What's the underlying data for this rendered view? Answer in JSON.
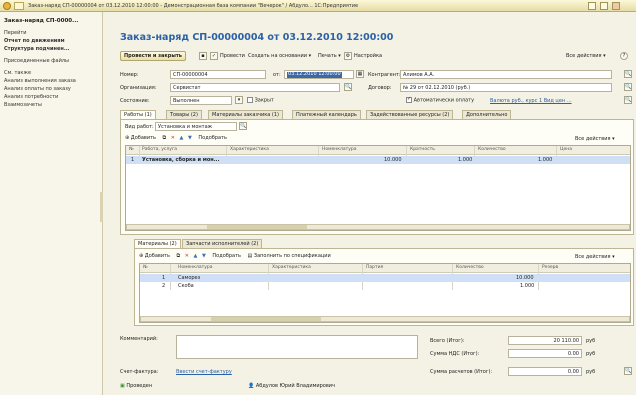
{
  "window": {
    "title": "Заказ-наряд СП-00000004 от 03.12.2010 12:00:00 - Демонстрационная база компании \"Вечерок\" / Абдуло... 1С:Предприятие"
  },
  "sidebar": {
    "items": [
      {
        "label": "Заказ-наряд СП-0000...",
        "bold": true
      },
      {
        "label": "Перейти",
        "bold": false
      },
      {
        "label": "Отчет по движениям",
        "bold": true
      },
      {
        "label": "Структура подчинен...",
        "bold": true
      },
      {
        "label": "Присоединенные файлы",
        "bold": false
      },
      {
        "label": "См. также",
        "bold": false
      },
      {
        "label": "Анализ выполнения заказа",
        "bold": false
      },
      {
        "label": "Анализ оплаты по заказу",
        "bold": false
      },
      {
        "label": "Анализ потребности",
        "bold": false
      },
      {
        "label": "Взаимозачеты",
        "bold": false
      }
    ]
  },
  "doc": {
    "title": "Заказ-наряд СП-00000004 от 03.12.2010 12:00:00"
  },
  "toolbar": {
    "post_close": "Провести и закрыть",
    "post": "Провести",
    "create_based": "Создать на основании",
    "print": "Печать",
    "settings": "Настройка",
    "all_actions": "Все действия"
  },
  "fields": {
    "number_label": "Номер:",
    "number_value": "СП-00000004",
    "date_label": "от:",
    "date_value": "03.12.2010 12:00:00",
    "counterparty_label": "Контрагент:",
    "counterparty_value": "Алимов А.А.",
    "org_label": "Организация:",
    "org_value": "Сервистат",
    "contract_label": "Договор:",
    "contract_value": "№ 29 от 02.12.2010 (руб.)",
    "state_label": "Состояние:",
    "state_value": "Выполнен",
    "closed_label": "Закрыт",
    "auto_pay_label": "Автоматически оплату",
    "currency_label": "Валюта руб., курс 1 Вид цен ..."
  },
  "tabs": [
    "Работы (1)",
    "Товары (2)",
    "Материалы заказчика (1)",
    "Платежный календарь",
    "Задействованные ресурсы (2)",
    "Дополнительно"
  ],
  "works": {
    "kind_label": "Вид работ:",
    "kind_value": "Установка и монтаж",
    "add": "Добавить",
    "pick": "Подобрать",
    "all_actions": "Все действия",
    "columns": [
      "№",
      "Работа, услуга",
      "Характеристика",
      "Номенклатура",
      "Кратность",
      "Количество",
      "Цена"
    ],
    "rows": [
      {
        "n": "1",
        "work": "Установка, сборка и мон...",
        "char": "",
        "nom": "10.000",
        "mult": "1.000",
        "qty": "1.000",
        "price": ""
      }
    ]
  },
  "materials": {
    "tabs": [
      "Материалы (2)",
      "Запчасти исполнителей (2)"
    ],
    "add": "Добавить",
    "pick": "Подобрать",
    "fill": "Заполнить по спецификации",
    "all_actions": "Все действия",
    "columns": [
      "№",
      "Номенклатура",
      "Характеристика",
      "Партия",
      "Количество",
      "Резерв"
    ],
    "rows": [
      {
        "n": "1",
        "nom": "Саморез",
        "char": "",
        "batch": "",
        "qty": "10.000",
        "res": ""
      },
      {
        "n": "2",
        "nom": "Скоба",
        "char": "",
        "batch": "",
        "qty": "1.000",
        "res": ""
      }
    ]
  },
  "footer": {
    "comment_label": "Комментарий:",
    "total_label": "Всего (Итог):",
    "total_value": "20 110.00",
    "vat_label": "Сумма НДС (Итог):",
    "vat_value": "0.00",
    "pay_label": "Сумма расчетов (Итог):",
    "pay_value": "0.00",
    "currency": "руб",
    "invoice_label": "Счет-фактура:",
    "invoice_link": "Ввести счет-фактуру",
    "posted": "Проведен",
    "author": "Абдулов Юрий Владимирович"
  },
  "colors": {
    "accent": "#2b61a7",
    "selection": "#3a68a8",
    "row_highlight": "#cfe0f6"
  }
}
